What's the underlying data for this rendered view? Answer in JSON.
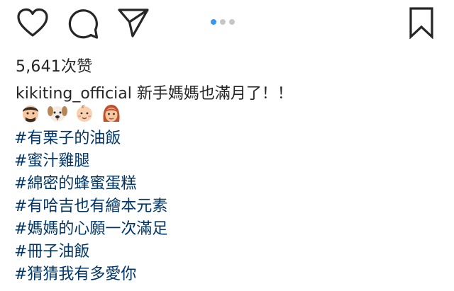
{
  "post": {
    "likes_text": "5,641次赞",
    "username": "kikiting_official",
    "caption_text": "新手媽媽也滿月了！！",
    "emojis": [
      "man-face-emoji-icon",
      "dog-face-emoji-icon",
      "baby-face-emoji-icon",
      "woman-face-emoji-icon"
    ],
    "hashtags": [
      "#有栗子的油飯",
      "#蜜汁雞腿",
      "#綿密的蜂蜜蛋糕",
      "#有哈吉也有繪本元素",
      "#媽媽的心願一次滿足",
      "#冊子油飯",
      "#猜猜我有多愛你"
    ]
  },
  "carousel": {
    "count": 3,
    "active_index": 0
  },
  "colors": {
    "text": "#262626",
    "hashtag": "#003569",
    "active_dot": "#3897f0",
    "inactive_dot": "#c7c7c7"
  },
  "icons": {
    "like": "heart-icon",
    "comment": "comment-bubble-icon",
    "share": "paper-plane-icon",
    "save": "bookmark-icon"
  }
}
